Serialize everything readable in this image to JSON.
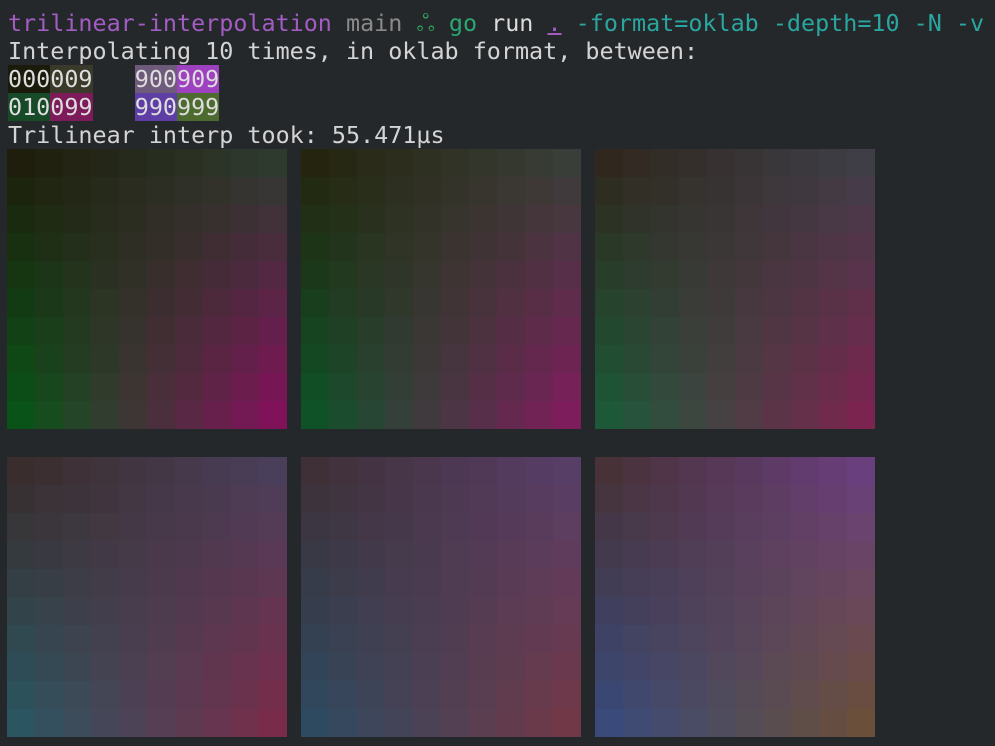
{
  "prompt": {
    "directory": "trilinear-interpolation",
    "branch": "main",
    "branch_icon": "ஃ",
    "command": "go",
    "subcommand": "run",
    "target": ".",
    "args": "-format=oklab -depth=10 -N -v",
    "colors": {
      "directory": "#a25cc4",
      "branch": "#8a8a8a",
      "branch_icon": "#2e9e5f",
      "command": "#2aa672",
      "args": "#2aa6a0",
      "target": "#a25cc4"
    }
  },
  "output": {
    "info": "Interpolating 10 times, in oklab format, between:",
    "corners_row1": [
      {
        "text": "000",
        "bg": "#1b1b0b"
      },
      {
        "text": "009",
        "bg": "#3a3a2a"
      },
      {
        "text": "   ",
        "bg": ""
      },
      {
        "text": "900",
        "bg": "#6e5a7a"
      },
      {
        "text": "909",
        "bg": "#9d41c0"
      }
    ],
    "corners_row2": [
      {
        "text": "010",
        "bg": "#174a27"
      },
      {
        "text": "099",
        "bg": "#7d1a5a"
      },
      {
        "text": "   ",
        "bg": ""
      },
      {
        "text": "990",
        "bg": "#5e3ea4"
      },
      {
        "text": "999",
        "bg": "#4d6b2e"
      }
    ],
    "timing": "Trilinear interp took: 55.471µs"
  },
  "tiles": [
    {
      "tl": "#1f1e0c",
      "tr": "#2f3a2f",
      "bl": "#0a5318",
      "br": "#80125a"
    },
    {
      "tl": "#25250f",
      "tr": "#3a3e38",
      "bl": "#0f5228",
      "br": "#7d1d5b"
    },
    {
      "tl": "#30281f",
      "tr": "#3f3e47",
      "bl": "#1d5838",
      "br": "#7a244f"
    },
    {
      "tl": "#3a2d2d",
      "tr": "#4a3f5a",
      "bl": "#2b5560",
      "br": "#782c4a"
    },
    {
      "tl": "#3f3038",
      "tr": "#573e67",
      "bl": "#2e4a60",
      "br": "#713847"
    },
    {
      "tl": "#473238",
      "tr": "#6a3f7d",
      "bl": "#3a4a7a",
      "br": "#6a4f3a"
    }
  ]
}
